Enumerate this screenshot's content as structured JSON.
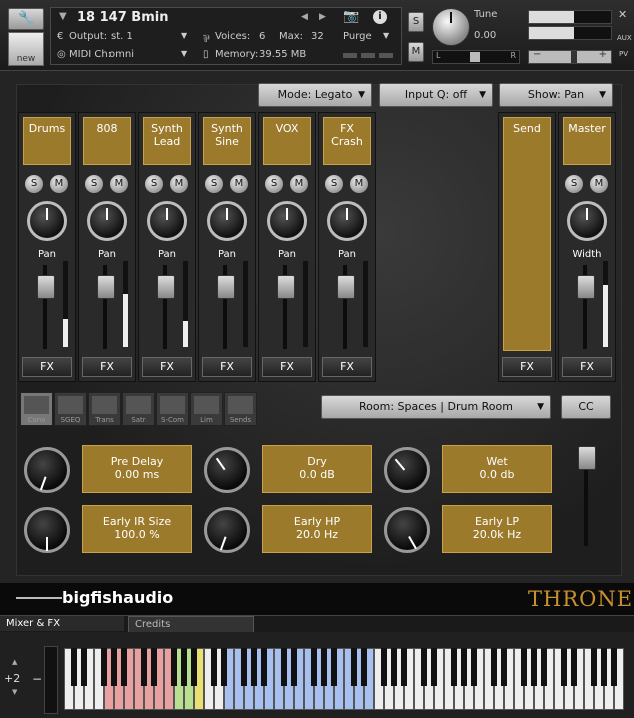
{
  "header": {
    "instrument_name": "18 147 Bmin",
    "output_label": "Output:",
    "output_value": "st. 1",
    "voices_label": "Voices:",
    "voices_value": "6",
    "max_label": "Max:",
    "max_value": "32",
    "purge_label": "Purge",
    "midi_label": "MIDI Ch:",
    "midi_value": "omni",
    "memory_label": "Memory:",
    "memory_value": "39.55 MB",
    "tune_label": "Tune",
    "tune_value": "0.00",
    "new_label": "new",
    "s_label": "S",
    "m_label": "M",
    "l_label": "L",
    "r_label": "R",
    "aux_label": "AUX",
    "pv_label": "PV"
  },
  "controls": {
    "mode": "Mode: Legato",
    "input_q": "Input Q: off",
    "show": "Show: Pan"
  },
  "channels": [
    {
      "name": "Drums",
      "knob_label": "Pan",
      "fx": "FX",
      "meter": 0.32
    },
    {
      "name": "808",
      "knob_label": "Pan",
      "fx": "FX",
      "meter": 0.62
    },
    {
      "name": "Synth Lead",
      "knob_label": "Pan",
      "fx": "FX",
      "meter": 0.3
    },
    {
      "name": "Synth Sine",
      "knob_label": "Pan",
      "fx": "FX",
      "meter": 0.0
    },
    {
      "name": "VOX",
      "knob_label": "Pan",
      "fx": "FX",
      "meter": 0.0
    },
    {
      "name": "FX Crash",
      "knob_label": "Pan",
      "fx": "FX",
      "meter": 0.0
    }
  ],
  "send": {
    "name": "Send",
    "fx": "FX"
  },
  "master": {
    "name": "Master",
    "knob_label": "Width",
    "fx": "FX",
    "meter": 0.72
  },
  "solo_label": "S",
  "mute_label": "M",
  "fx_tabs": [
    "Conv",
    "SGEQ",
    "Trans",
    "Satr",
    "S-Com",
    "Lim",
    "Sends"
  ],
  "room": {
    "label": "Room: Spaces | Drum Room",
    "cc": "CC"
  },
  "params": [
    {
      "name": "Pre Delay",
      "value": "0.00 ms"
    },
    {
      "name": "Dry",
      "value": "0.0 dB"
    },
    {
      "name": "Wet",
      "value": "0.0 db"
    },
    {
      "name": "Early IR Size",
      "value": "100.0 %"
    },
    {
      "name": "Early HP",
      "value": "20.0 Hz"
    },
    {
      "name": "Early LP",
      "value": "20.0k Hz"
    }
  ],
  "footer": {
    "brand": "bigfishaudio",
    "product": "THRONE",
    "tab_mixer": "Mixer & FX",
    "tab_credits": "Credits",
    "octave": "+2",
    "minus": "−"
  },
  "colors": {
    "gold": "#9c7a2c",
    "product_gold": "#c9902e",
    "key_red": "#e8a0a0",
    "key_green": "#b8e090",
    "key_yellow": "#e8e070",
    "key_blue": "#a8c0f0"
  }
}
